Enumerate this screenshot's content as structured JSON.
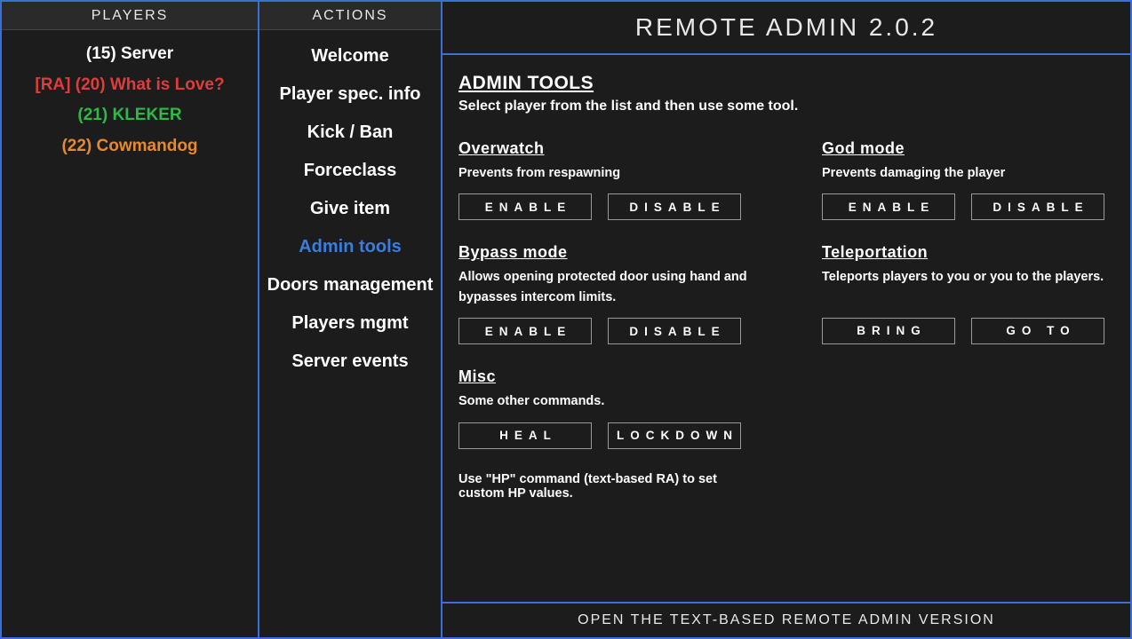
{
  "header": {
    "players": "PLAYERS",
    "actions": "ACTIONS",
    "title": "REMOTE ADMIN 2.0.2"
  },
  "players": {
    "server": "(15) Server",
    "ra_love": "[RA] (20) What is Love?",
    "kleker": "(21) KLEKER",
    "cowmandog": "(22) Cowmandog"
  },
  "actions": [
    "Welcome",
    "Player spec. info",
    "Kick / Ban",
    "Forceclass",
    "Give item",
    "Admin tools",
    "Doors management",
    "Players mgmt",
    "Server events"
  ],
  "active_action_index": 5,
  "main": {
    "title": "ADMIN TOOLS",
    "subtitle": "Select player from the list and then use some tool.",
    "overwatch": {
      "title": "Overwatch",
      "desc": "Prevents from respawning",
      "btn1": "ENABLE",
      "btn2": "DISABLE"
    },
    "godmode": {
      "title": "God mode",
      "desc": "Prevents damaging the player",
      "btn1": "ENABLE",
      "btn2": "DISABLE"
    },
    "bypass": {
      "title": "Bypass mode",
      "desc": "Allows opening protected door using hand and bypasses intercom limits.",
      "btn1": "ENABLE",
      "btn2": "DISABLE"
    },
    "teleport": {
      "title": "Teleportation",
      "desc": "Teleports players to you or you to the players.",
      "btn1": "BRING",
      "btn2": "GO TO"
    },
    "misc": {
      "title": "Misc",
      "desc": "Some other commands.",
      "btn1": "HEAL",
      "btn2": "LOCKDOWN"
    },
    "footnote": "Use \"HP\" command (text-based RA) to set custom HP values."
  },
  "footer": "OPEN THE TEXT-BASED REMOTE ADMIN VERSION"
}
